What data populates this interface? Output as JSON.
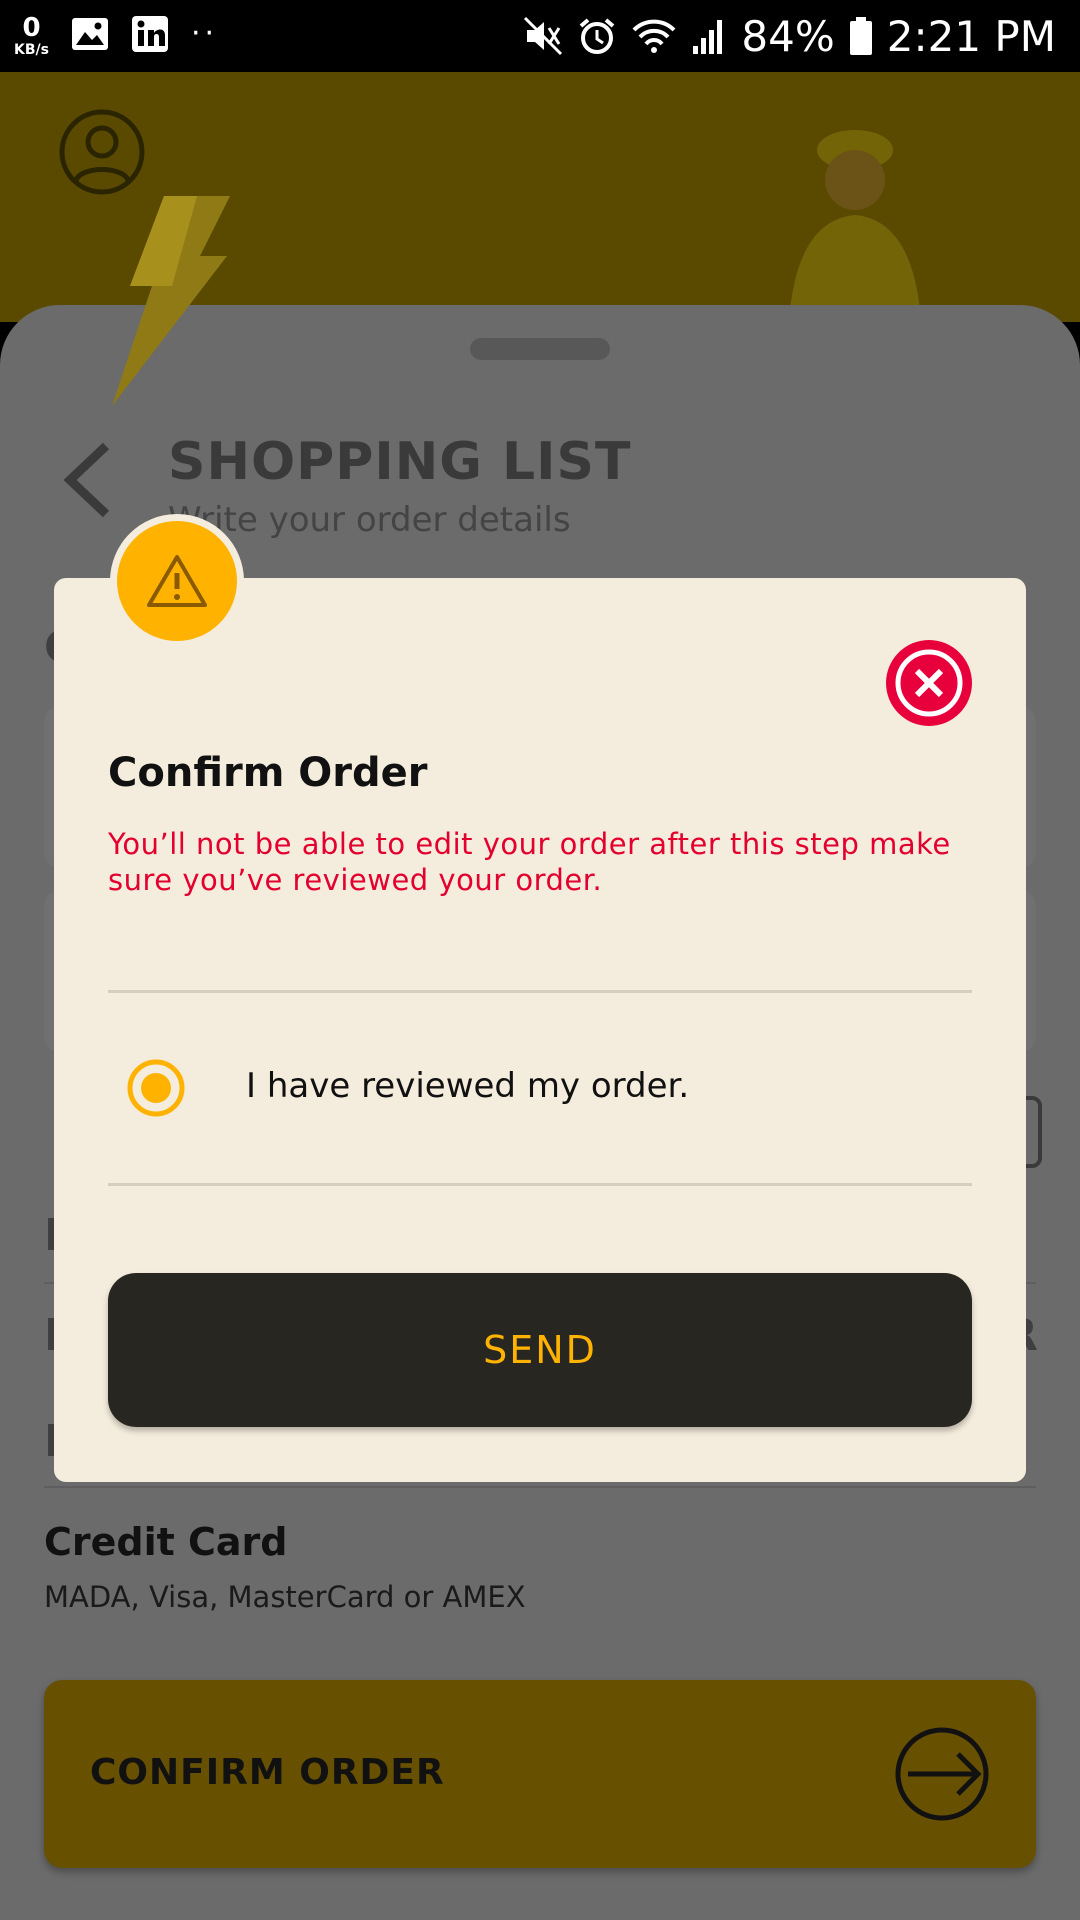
{
  "status_bar": {
    "kbs_value": "0",
    "kbs_unit": "KB/s",
    "dots": "··",
    "battery": "84%",
    "time": "2:21 PM",
    "icons": [
      "image-icon",
      "linkedin-icon",
      "mute-icon",
      "alarm-icon",
      "wifi-icon",
      "signal-icon",
      "battery-icon"
    ]
  },
  "screen": {
    "title": "SHOPPING LIST",
    "subtitle": "Write your order details",
    "ghost_letters": [
      "C",
      "F",
      "D",
      "R",
      "E"
    ],
    "payment": {
      "title": "Credit Card",
      "subtitle": "MADA, Visa, MasterCard or AMEX"
    },
    "confirm_button": "CONFIRM ORDER"
  },
  "dialog": {
    "title": "Confirm Order",
    "warning": "You’ll not be able to edit your order after this step make sure you’ve reviewed your order.",
    "checkbox_label": "I have reviewed my order.",
    "checkbox_selected": true,
    "send_button": "SEND"
  },
  "colors": {
    "accent": "#ffb300",
    "danger": "#e3002f",
    "dialog_bg": "#f4ecdc",
    "send_bg": "#282620"
  }
}
